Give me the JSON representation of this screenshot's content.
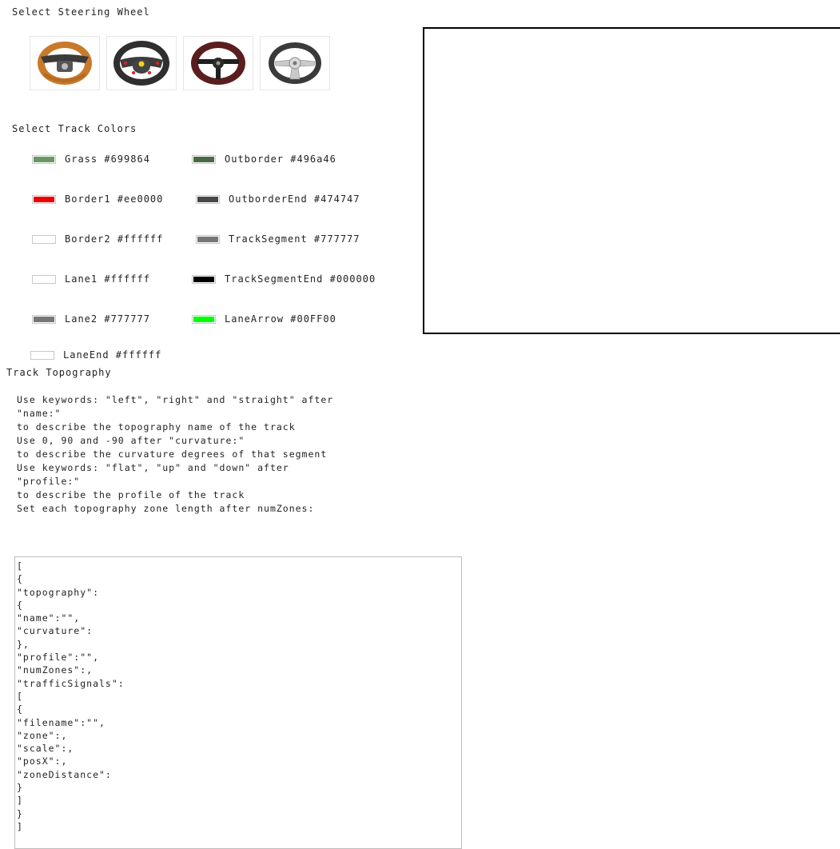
{
  "steering": {
    "title": "Select Steering Wheel",
    "wheels": [
      {
        "name": "orange-sport-wheel",
        "color": "#c87a2a"
      },
      {
        "name": "ferrari-wheel",
        "color": "#2f2f2f"
      },
      {
        "name": "wood-racing-wheel",
        "color": "#5a1e1e"
      },
      {
        "name": "silver-spoke-wheel",
        "color": "#3a3a3a"
      }
    ]
  },
  "track_colors": {
    "title": "Select Track Colors",
    "left": [
      {
        "label": "Grass #699864",
        "color": "#699864"
      },
      {
        "label": "Border1 #ee0000",
        "color": "#ee0000"
      },
      {
        "label": "Border2 #ffffff",
        "color": "#ffffff"
      },
      {
        "label": "Lane1 #ffffff",
        "color": "#ffffff"
      },
      {
        "label": "Lane2 #777777",
        "color": "#777777"
      },
      {
        "label": "LaneEnd #ffffff",
        "color": "#ffffff"
      }
    ],
    "right": [
      {
        "label": "Outborder #496a46",
        "color": "#496a46"
      },
      {
        "label": "OutborderEnd #474747",
        "color": "#474747"
      },
      {
        "label": "TrackSegment #777777",
        "color": "#777777"
      },
      {
        "label": "TrackSegmentEnd #000000",
        "color": "#000000"
      },
      {
        "label": "LaneArrow #00FF00",
        "color": "#00ff00"
      }
    ]
  },
  "topography": {
    "title": "Track Topography",
    "instructions": [
      "Use keywords: \"left\", \"right\" and \"straight\" after \"name:\"",
      "to describe the topography name of the track",
      "Use 0, 90 and -90 after \"curvature:\"",
      "to describe the curvature degrees of that segment",
      "Use keywords: \"flat\", \"up\" and \"down\" after \"profile:\"",
      "to describe the profile of the track",
      "Set each topography zone length after numZones:"
    ],
    "textarea_value": "[\n{\n\"topography\":\n{\n\"name\":\"\",\n\"curvature\":\n},\n\"profile\":\"\",\n\"numZones\":,\n\"trafficSignals\":\n[\n{\n\"filename\":\"\",\n\"zone\":,\n\"scale\":,\n\"posX\":,\n\"zoneDistance\":\n}\n]\n}\n]"
  }
}
